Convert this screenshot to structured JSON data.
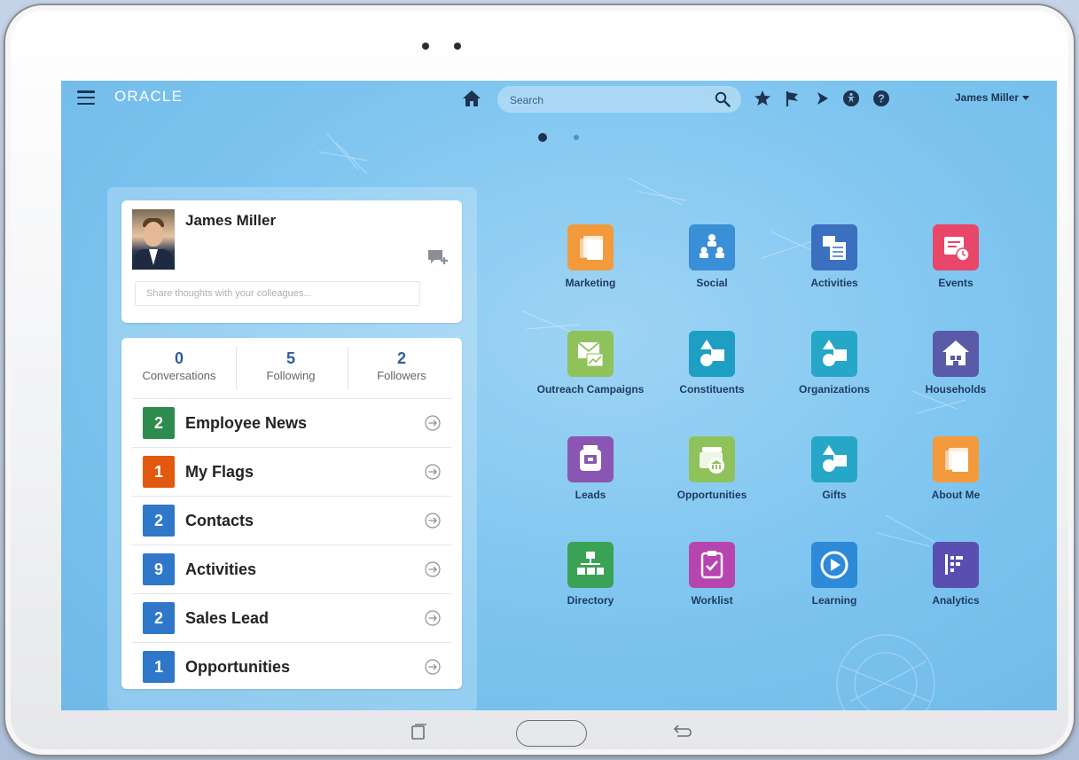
{
  "topbar": {
    "logo": "ORACLE",
    "search_placeholder": "Search",
    "user_name": "James Miller"
  },
  "profile": {
    "name": "James Miller",
    "share_placeholder": "Share thoughts with your colleagues..."
  },
  "stats": [
    {
      "value": "0",
      "label": "Conversations"
    },
    {
      "value": "5",
      "label": "Following"
    },
    {
      "value": "2",
      "label": "Followers"
    }
  ],
  "list_items": [
    {
      "count": "2",
      "label": "Employee News",
      "color": "#2e8b4e"
    },
    {
      "count": "1",
      "label": "My Flags",
      "color": "#e0590f"
    },
    {
      "count": "2",
      "label": "Contacts",
      "color": "#2f77c9"
    },
    {
      "count": "9",
      "label": "Activities",
      "color": "#2f77c9"
    },
    {
      "count": "2",
      "label": "Sales Lead",
      "color": "#2f77c9"
    },
    {
      "count": "1",
      "label": "Opportunities",
      "color": "#2f77c9"
    }
  ],
  "apps": [
    {
      "label": "Marketing",
      "icon": "stack-icon",
      "color": "#f39a3c"
    },
    {
      "label": "Social",
      "icon": "people-network-icon",
      "color": "#3a8fd6"
    },
    {
      "label": "Activities",
      "icon": "calendar-icon",
      "color": "#3b6fbf"
    },
    {
      "label": "Events",
      "icon": "event-clock-icon",
      "color": "#e8476a"
    },
    {
      "label": "Outreach Campaigns",
      "icon": "envelope-chart-icon",
      "color": "#8fc25a"
    },
    {
      "label": "Constituents",
      "icon": "shapes-icon",
      "color": "#1f9ec4"
    },
    {
      "label": "Organizations",
      "icon": "shapes-icon",
      "color": "#27a7c7"
    },
    {
      "label": "Households",
      "icon": "house-icon",
      "color": "#5a5aa9"
    },
    {
      "label": "Leads",
      "icon": "badge-icon",
      "color": "#8a56b3"
    },
    {
      "label": "Opportunities",
      "icon": "briefcase-bank-icon",
      "color": "#8fc25a"
    },
    {
      "label": "Gifts",
      "icon": "shapes-icon",
      "color": "#27a7c7"
    },
    {
      "label": "About Me",
      "icon": "stack-icon",
      "color": "#f39a3c"
    },
    {
      "label": "Directory",
      "icon": "org-chart-icon",
      "color": "#3aa255"
    },
    {
      "label": "Worklist",
      "icon": "clipboard-check-icon",
      "color": "#b745b0"
    },
    {
      "label": "Learning",
      "icon": "play-circle-icon",
      "color": "#2c8ad8"
    },
    {
      "label": "Analytics",
      "icon": "bar-list-icon",
      "color": "#5a4fb0"
    }
  ]
}
